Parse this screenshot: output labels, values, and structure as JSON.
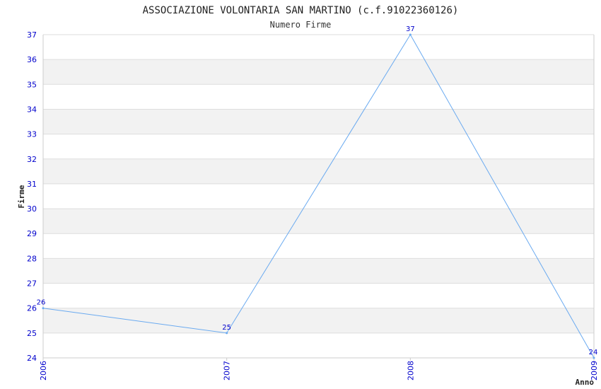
{
  "colors": {
    "line": "#6aaaf0",
    "tick_text": "#0000cc",
    "band": "#f2f2f2",
    "grid": "#dddddd",
    "axis": "#cccccc"
  },
  "chart_data": {
    "type": "line",
    "title": "ASSOCIAZIONE VOLONTARIA SAN MARTINO (c.f.91022360126)",
    "subtitle": "Numero Firme",
    "xlabel": "Anno",
    "ylabel": "Firme",
    "x": [
      "2006",
      "2007",
      "2008",
      "2009"
    ],
    "series": [
      {
        "values": [
          26,
          25,
          37,
          24
        ]
      }
    ],
    "ylim": [
      24,
      37
    ],
    "yticks": [
      24,
      25,
      26,
      27,
      28,
      29,
      30,
      31,
      32,
      33,
      34,
      35,
      36,
      37
    ],
    "grid": true,
    "alternating_bands": true
  }
}
